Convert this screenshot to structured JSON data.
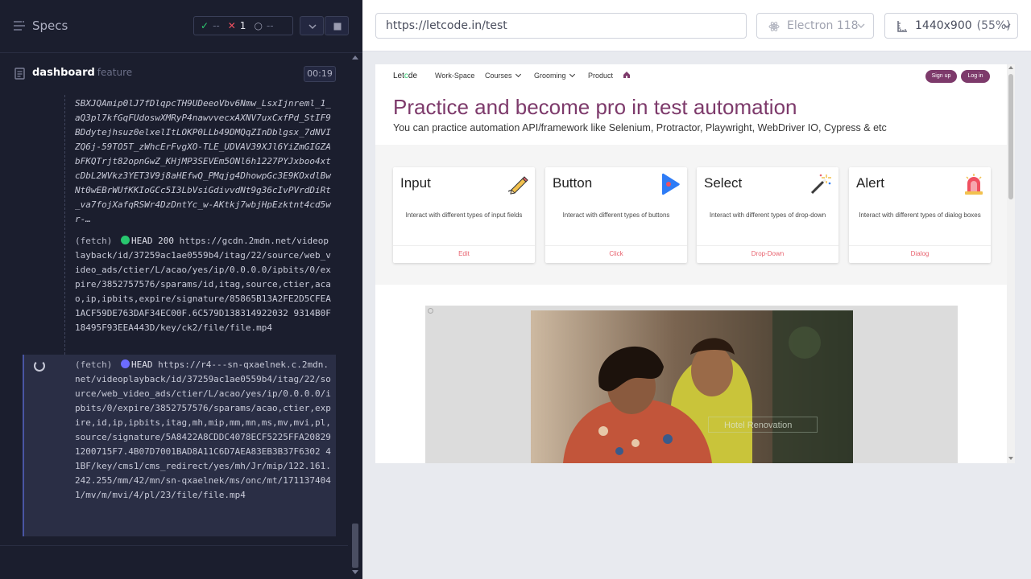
{
  "reporter": {
    "title": "Specs",
    "stats": {
      "passed": "--",
      "failed": "1",
      "pending": "--"
    },
    "spec": {
      "name": "dashboard",
      "ext": "feature",
      "duration": "00:19"
    },
    "log_hash": "SBXJQAmip0lJ7fDlqpcTH9UDeeoVbv6Nmw_LsxIjnreml_1_aQ3pl7kfGqFUdoswXMRyP4nawvvecxAXNV7uxCxfPd_StIF9BDdytejhsuz0elxelItLOKP0LLb49DMQqZInDblgsx_7dNVIZQ6j-59TO5T_zWhcErFvgXO-TLE_UDVAV39XJl6YiZmGIGZAbFKQTrjt82opnGwZ_KHjMP3SEVEm5ONl6h1227PYJxboo4xtcDbL2WVkz3YET3V9j8aHEfwQ_PMqjg4DhowpGc3E9KOxdlBwNt0wEBrWUfKKIoGCc5I3LbVsiGdivvdNt9g36cIvPVrdDiRt_va7fojXafqRSWr4DzDntYc_w-AKtkj7wbjHpEzktnt4cd5wr-…",
    "logs": [
      {
        "command": "(fetch)",
        "method": "HEAD",
        "status": "200",
        "url": "https://gcdn.2mdn.net/videoplayback/id/37259ac1ae0559b4/itag/22/source/web_video_ads/ctier/L/acao/yes/ip/0.0.0.0/ipbits/0/expire/3852757576/sparams/id,itag,source,ctier,acao,ip,ipbits,expire/signature/85865B13A2FE2D5CFEA1ACF59DE763DAF34EC00F.6C579D138314922032 9314B0F18495F93EEA443D/key/ck2/file/file.mp4"
      },
      {
        "command": "(fetch)",
        "method": "HEAD",
        "status": "",
        "url": "https://r4---sn-qxaelnek.c.2mdn.net/videoplayback/id/37259ac1ae0559b4/itag/22/source/web_video_ads/ctier/L/acao/yes/ip/0.0.0.0/ipbits/0/expire/3852757576/sparams/acao,ctier,expire,id,ip,ipbits,itag,mh,mip,mm,mn,ms,mv,mvi,pl,source/signature/5A8422A8CDDC4078ECF5225FFA208291200715F7.4B07D7001BAD8A11C6D7AEA83EB3B37F6302 41BF/key/cms1/cms_redirect/yes/mh/Jr/mip/122.161.242.255/mm/42/mn/sn-qxaelnek/ms/onc/mt/1711374041/mv/m/mvi/4/pl/23/file/file.mp4"
      }
    ]
  },
  "aut": {
    "url": "https://letcode.in/test",
    "browser": "Electron 118",
    "viewport": "1440x900",
    "scale": "(55%)"
  },
  "site": {
    "logo_pre": "Let",
    "logo_mid": "c",
    "logo_post": "de",
    "nav": {
      "workspace": "Work-Space",
      "courses": "Courses",
      "grooming": "Grooming",
      "product": "Product"
    },
    "signup": "Sign up",
    "login": "Log in",
    "hero_title": "Practice and become pro in test automation",
    "hero_subtitle": "You can practice automation API/framework like Selenium, Protractor, Playwright, WebDriver IO, Cypress & etc",
    "cards": [
      {
        "title": "Input",
        "desc": "Interact with different types of input fields",
        "link": "Edit"
      },
      {
        "title": "Button",
        "desc": "Interact with different types of buttons",
        "link": "Click"
      },
      {
        "title": "Select",
        "desc": "Interact with different types of drop-down",
        "link": "Drop-Down"
      },
      {
        "title": "Alert",
        "desc": "Interact with different types of dialog boxes",
        "link": "Dialog"
      }
    ],
    "video_caption": "Hotel Renovation"
  },
  "colors": {
    "reporter_bg": "#1b1e2e",
    "brand": "#7d3a6b",
    "link": "#e8636f",
    "pass": "#2ecc71",
    "fail": "#f05060"
  }
}
